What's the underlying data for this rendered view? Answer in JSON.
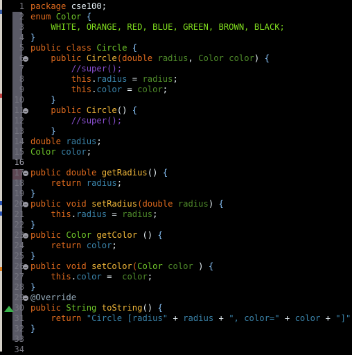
{
  "editor": {
    "language": "java",
    "current_line": 16,
    "lines": [
      {
        "n": "1",
        "tokens": [
          [
            "k",
            "package "
          ],
          [
            "p",
            "cse100;"
          ]
        ]
      },
      {
        "n": "2",
        "tokens": [
          [
            "k",
            "enum "
          ],
          [
            "t",
            "Color "
          ],
          [
            "br",
            "{"
          ]
        ]
      },
      {
        "n": "3",
        "tokens": [
          [
            "p",
            "    "
          ],
          [
            "e",
            "WHITE, ORANGE, RED, BLUE, GREEN, BROWN, BLACK;"
          ]
        ]
      },
      {
        "n": "4",
        "tokens": [
          [
            "br",
            "}"
          ]
        ]
      },
      {
        "n": "5",
        "tokens": [
          [
            "k",
            "public class "
          ],
          [
            "t",
            "Circle "
          ],
          [
            "br",
            "{"
          ]
        ]
      },
      {
        "n": "6",
        "tokens": [
          [
            "p",
            "    "
          ],
          [
            "k",
            "public "
          ],
          [
            "m",
            "Circle"
          ],
          [
            "k",
            "("
          ],
          [
            "k",
            "double "
          ],
          [
            "tg",
            "radius"
          ],
          [
            "p",
            ", "
          ],
          [
            "tg",
            "Color color"
          ],
          [
            "p",
            ") "
          ],
          [
            "br",
            "{"
          ]
        ]
      },
      {
        "n": "7",
        "tokens": [
          [
            "p",
            "        "
          ],
          [
            "c",
            "//super();"
          ]
        ]
      },
      {
        "n": "8",
        "tokens": [
          [
            "p",
            "        "
          ],
          [
            "k",
            "this"
          ],
          [
            "p",
            "."
          ],
          [
            "f",
            "radius"
          ],
          [
            "p",
            " = "
          ],
          [
            "tg",
            "radius"
          ],
          [
            "p",
            ";"
          ]
        ]
      },
      {
        "n": "9",
        "tokens": [
          [
            "p",
            "        "
          ],
          [
            "k",
            "this"
          ],
          [
            "p",
            "."
          ],
          [
            "f",
            "color"
          ],
          [
            "p",
            " = "
          ],
          [
            "tg",
            "color"
          ],
          [
            "p",
            ";"
          ]
        ]
      },
      {
        "n": "10",
        "tokens": [
          [
            "p",
            "    "
          ],
          [
            "br",
            "}"
          ]
        ]
      },
      {
        "n": "11",
        "tokens": [
          [
            "p",
            "    "
          ],
          [
            "k",
            "public "
          ],
          [
            "m",
            "Circle"
          ],
          [
            "p",
            "() "
          ],
          [
            "br",
            "{"
          ]
        ]
      },
      {
        "n": "12",
        "tokens": [
          [
            "p",
            "        "
          ],
          [
            "c",
            "//super();"
          ]
        ]
      },
      {
        "n": "13",
        "tokens": [
          [
            "p",
            "    "
          ],
          [
            "br",
            "}"
          ]
        ]
      },
      {
        "n": "14",
        "tokens": [
          [
            "k",
            "double "
          ],
          [
            "f",
            "radius"
          ],
          [
            "p",
            ";"
          ]
        ]
      },
      {
        "n": "15",
        "tokens": [
          [
            "t",
            "Color "
          ],
          [
            "f",
            "color"
          ],
          [
            "p",
            ";"
          ]
        ]
      },
      {
        "n": "16",
        "tokens": []
      },
      {
        "n": "17",
        "tokens": [
          [
            "k",
            "public double "
          ],
          [
            "m",
            "getRadius"
          ],
          [
            "p",
            "() "
          ],
          [
            "br",
            "{"
          ]
        ]
      },
      {
        "n": "18",
        "tokens": [
          [
            "p",
            "    "
          ],
          [
            "k",
            "return "
          ],
          [
            "f",
            "radius"
          ],
          [
            "p",
            ";"
          ]
        ]
      },
      {
        "n": "19",
        "tokens": [
          [
            "br",
            "}"
          ]
        ]
      },
      {
        "n": "20",
        "tokens": [
          [
            "k",
            "public void "
          ],
          [
            "m",
            "setRadius"
          ],
          [
            "k",
            "("
          ],
          [
            "k",
            "double "
          ],
          [
            "tg",
            "radius"
          ],
          [
            "p",
            ") "
          ],
          [
            "br",
            "{"
          ]
        ]
      },
      {
        "n": "21",
        "tokens": [
          [
            "p",
            "    "
          ],
          [
            "k",
            "this"
          ],
          [
            "p",
            "."
          ],
          [
            "f",
            "radius"
          ],
          [
            "p",
            " = "
          ],
          [
            "tg",
            "radius"
          ],
          [
            "p",
            ";"
          ]
        ]
      },
      {
        "n": "22",
        "tokens": [
          [
            "br",
            "}"
          ]
        ]
      },
      {
        "n": "23",
        "tokens": [
          [
            "k",
            "public "
          ],
          [
            "t",
            "Color "
          ],
          [
            "m",
            "getColor "
          ],
          [
            "p",
            "() "
          ],
          [
            "br",
            "{"
          ]
        ]
      },
      {
        "n": "24",
        "tokens": [
          [
            "p",
            "    "
          ],
          [
            "k",
            "return "
          ],
          [
            "f",
            "color"
          ],
          [
            "p",
            ";"
          ]
        ]
      },
      {
        "n": "25",
        "tokens": [
          [
            "br",
            "}"
          ]
        ]
      },
      {
        "n": "26",
        "tokens": [
          [
            "k",
            "public void "
          ],
          [
            "m",
            "setColor"
          ],
          [
            "k",
            "("
          ],
          [
            "t",
            "Color "
          ],
          [
            "tg",
            "color "
          ],
          [
            "p",
            ") "
          ],
          [
            "br",
            "{"
          ]
        ]
      },
      {
        "n": "27",
        "tokens": [
          [
            "p",
            "    "
          ],
          [
            "k",
            "this"
          ],
          [
            "p",
            "."
          ],
          [
            "f",
            "color"
          ],
          [
            "p",
            " =  "
          ],
          [
            "tg",
            "color"
          ],
          [
            "p",
            ";"
          ]
        ]
      },
      {
        "n": "28",
        "tokens": [
          [
            "br",
            "}"
          ]
        ]
      },
      {
        "n": "29",
        "tokens": [
          [
            "a",
            "@Override"
          ]
        ]
      },
      {
        "n": "30",
        "tokens": [
          [
            "k",
            "public "
          ],
          [
            "t",
            "String "
          ],
          [
            "m",
            "toString"
          ],
          [
            "p",
            "() "
          ],
          [
            "br",
            "{"
          ]
        ]
      },
      {
        "n": "31",
        "tokens": [
          [
            "p",
            "    "
          ],
          [
            "k",
            "return "
          ],
          [
            "s",
            "\"Circle [radius\""
          ],
          [
            "p",
            " + "
          ],
          [
            "f",
            "radius"
          ],
          [
            "p",
            " + "
          ],
          [
            "s",
            "\", color=\""
          ],
          [
            "p",
            " + "
          ],
          [
            "f",
            "color"
          ],
          [
            "p",
            " + "
          ],
          [
            "s",
            "\"]\""
          ],
          [
            "p",
            ";"
          ]
        ]
      },
      {
        "n": "32",
        "tokens": [
          [
            "br",
            "}"
          ]
        ]
      },
      {
        "n": "33",
        "tokens": []
      },
      {
        "n": "34",
        "tokens": []
      }
    ],
    "fold_markers": [
      "6",
      "11",
      "17",
      "20",
      "23",
      "26",
      "29"
    ],
    "warning_markers": [
      "30"
    ]
  }
}
